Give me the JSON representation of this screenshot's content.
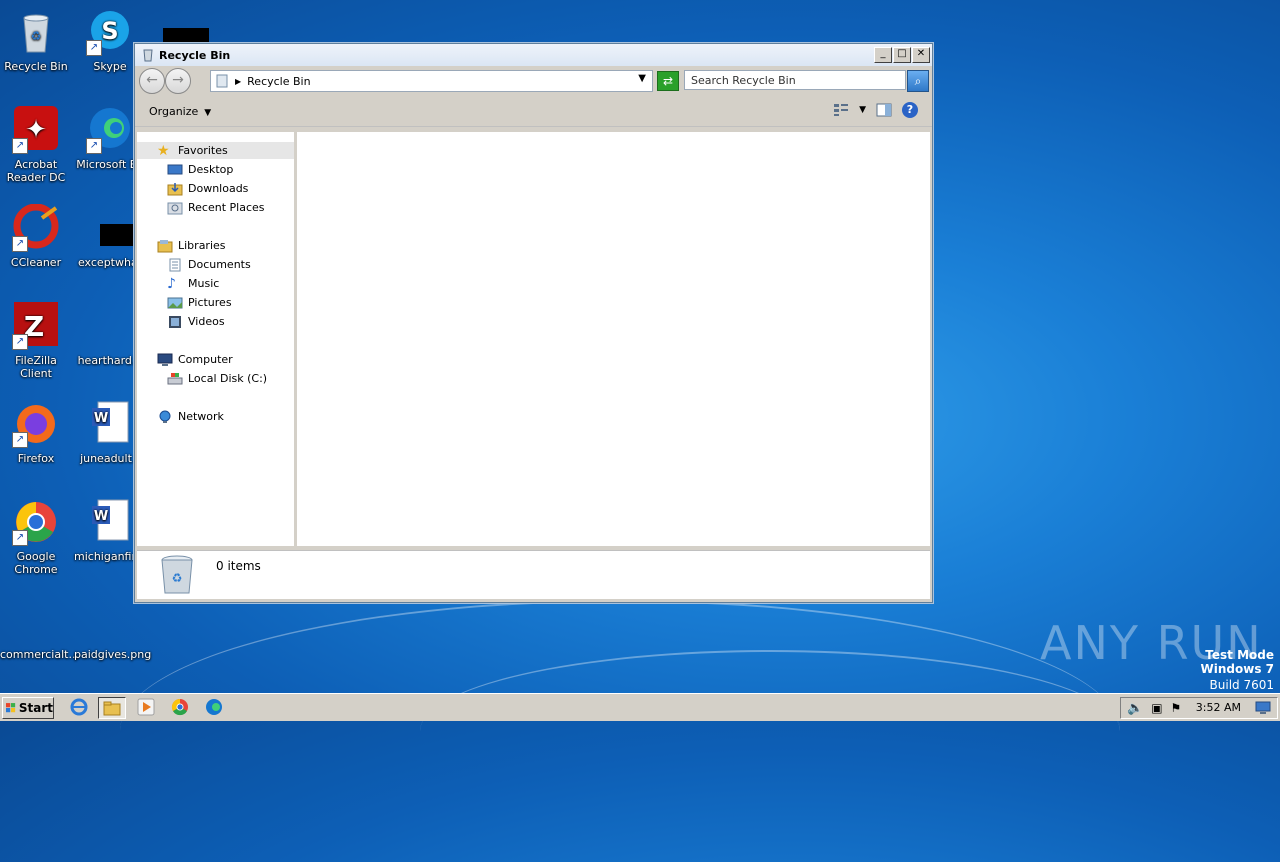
{
  "desktop": {
    "icons": [
      {
        "label": "Recycle Bin"
      },
      {
        "label": "Skype"
      },
      {
        "label": "Acrobat Reader DC"
      },
      {
        "label": "Microsoft Ed"
      },
      {
        "label": "CCleaner"
      },
      {
        "label": "exceptwhat"
      },
      {
        "label": "FileZilla Client"
      },
      {
        "label": "hearthard.p"
      },
      {
        "label": "Firefox"
      },
      {
        "label": "juneadult.r"
      },
      {
        "label": "Google Chrome"
      },
      {
        "label": "michiganfirm"
      },
      {
        "label": "commercialt..."
      },
      {
        "label": "paidgives.png"
      }
    ]
  },
  "window": {
    "title": "Recycle Bin",
    "address": "Recycle Bin",
    "search_placeholder": "Search Recycle Bin",
    "organize_label": "Organize",
    "nav": {
      "favorites": "Favorites",
      "desktop": "Desktop",
      "downloads": "Downloads",
      "recent": "Recent Places",
      "libraries": "Libraries",
      "documents": "Documents",
      "music": "Music",
      "pictures": "Pictures",
      "videos": "Videos",
      "computer": "Computer",
      "local_disk": "Local Disk (C:)",
      "network": "Network"
    },
    "status": "0 items"
  },
  "taskbar": {
    "start_label": "Start",
    "clock": "3:52 AM"
  },
  "watermark": {
    "line1": "Test Mode",
    "line2": "Windows 7",
    "line3": "Build 7601",
    "brand": "ANY RUN"
  }
}
